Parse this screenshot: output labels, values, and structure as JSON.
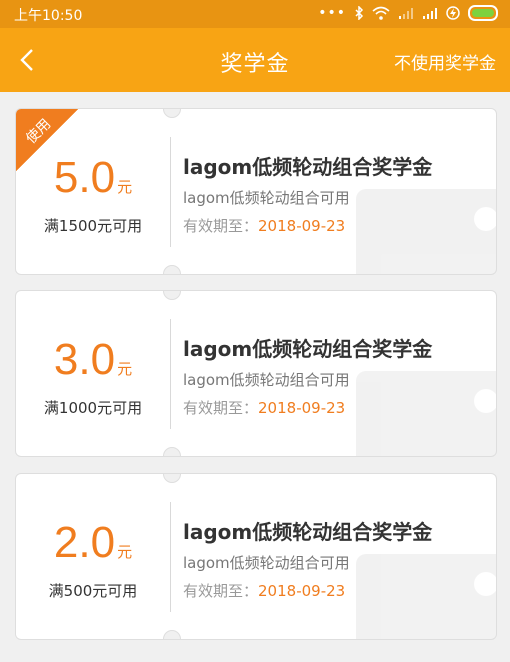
{
  "status_bar": {
    "time": "上午10:50",
    "battery_color": "#7cd23e"
  },
  "nav": {
    "title": "奖学金",
    "right_action": "不使用奖学金"
  },
  "cards": [
    {
      "badge": "使用",
      "amount": "5.0",
      "unit": "元",
      "condition": "满1500元可用",
      "title": "lagom低频轮动组合奖学金",
      "subtitle": "lagom低频轮动组合可用",
      "expiry_label": "有效期至：",
      "expiry_date": "2018-09-23"
    },
    {
      "amount": "3.0",
      "unit": "元",
      "condition": "满1000元可用",
      "title": "lagom低频轮动组合奖学金",
      "subtitle": "lagom低频轮动组合可用",
      "expiry_label": "有效期至：",
      "expiry_date": "2018-09-23"
    },
    {
      "amount": "2.0",
      "unit": "元",
      "condition": "满500元可用",
      "title": "lagom低频轮动组合奖学金",
      "subtitle": "lagom低频轮动组合可用",
      "expiry_label": "有效期至：",
      "expiry_date": "2018-09-23"
    }
  ],
  "colors": {
    "accent": "#f07d1f",
    "navbar": "#f8a414",
    "statusbar": "#e89412"
  }
}
